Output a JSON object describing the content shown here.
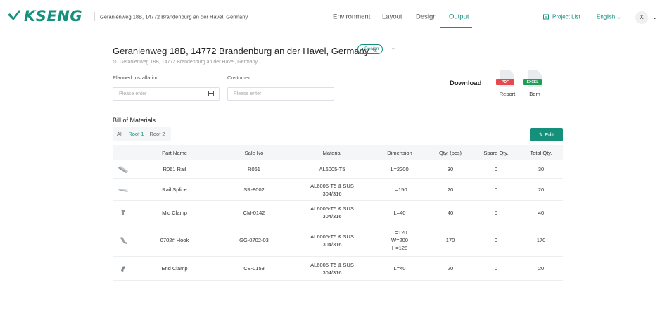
{
  "header": {
    "logo_text": "KSENG",
    "address": "Geranienweg 18B, 14772 Brandenburg an der Havel, Germany",
    "nav": [
      "Environment",
      "Layout",
      "Design",
      "Output"
    ],
    "active_nav": "Output",
    "project_list": "Project List",
    "language": "English ⌄",
    "avatar_letter": "X"
  },
  "title": {
    "text": "Geranienweg 18B, 14772 Brandenburg an der Havel, Germany",
    "badge": "• Design",
    "subtitle": "Geranienweg 18B, 14772 Brandenburg an der Havel, Germany"
  },
  "form": {
    "planned_label": "Planned Installation",
    "planned_placeholder": "Please enter",
    "customer_label": "Customer",
    "customer_placeholder": "Please enter"
  },
  "download": {
    "label": "Download",
    "report": {
      "tag": "PDF",
      "label": "Report",
      "color": "#e5484d"
    },
    "bom": {
      "tag": "EXCEL",
      "label": "Bom",
      "color": "#1f9d55"
    }
  },
  "bom": {
    "title": "Bill of Materials",
    "tabs": [
      "All",
      "Roof 1",
      "Roof 2"
    ],
    "active_tab": "Roof 1",
    "edit_label": "Edit",
    "columns": [
      "",
      "Part Name",
      "Sale No",
      "Material",
      "Dimension",
      "Qty. (pcs)",
      "Spare Qty.",
      "Total Qty."
    ],
    "rows": [
      {
        "name": "R061 Rail",
        "sale_no": "R061",
        "material": [
          "AL6005-T5"
        ],
        "dimension": [
          "L=2200"
        ],
        "qty": "30",
        "spare": "0",
        "total": "30",
        "icon": "rail-icon"
      },
      {
        "name": "Rail Splice",
        "sale_no": "SR-8002",
        "material": [
          "AL6005-T5 & SUS",
          "304/316"
        ],
        "dimension": [
          "L=150"
        ],
        "qty": "20",
        "spare": "0",
        "total": "20",
        "icon": "splice-icon"
      },
      {
        "name": "Mid Clamp",
        "sale_no": "CM-0142",
        "material": [
          "AL6005-T5 & SUS",
          "304/316"
        ],
        "dimension": [
          "L=40"
        ],
        "qty": "40",
        "spare": "0",
        "total": "40",
        "icon": "mid-clamp-icon"
      },
      {
        "name": "0702# Hook",
        "sale_no": "GG-0702-03",
        "material": [
          "AL6005-T5 & SUS",
          "304/316"
        ],
        "dimension": [
          "L=120",
          "W=200",
          "H=128"
        ],
        "qty": "170",
        "spare": "0",
        "total": "170",
        "icon": "hook-icon"
      },
      {
        "name": "End Clamp",
        "sale_no": "CE-0153",
        "material": [
          "AL6005-T5 & SUS",
          "304/316"
        ],
        "dimension": [
          "L=40"
        ],
        "qty": "20",
        "spare": "0",
        "total": "20",
        "icon": "end-clamp-icon"
      }
    ]
  },
  "colors": {
    "accent": "#15907b"
  }
}
